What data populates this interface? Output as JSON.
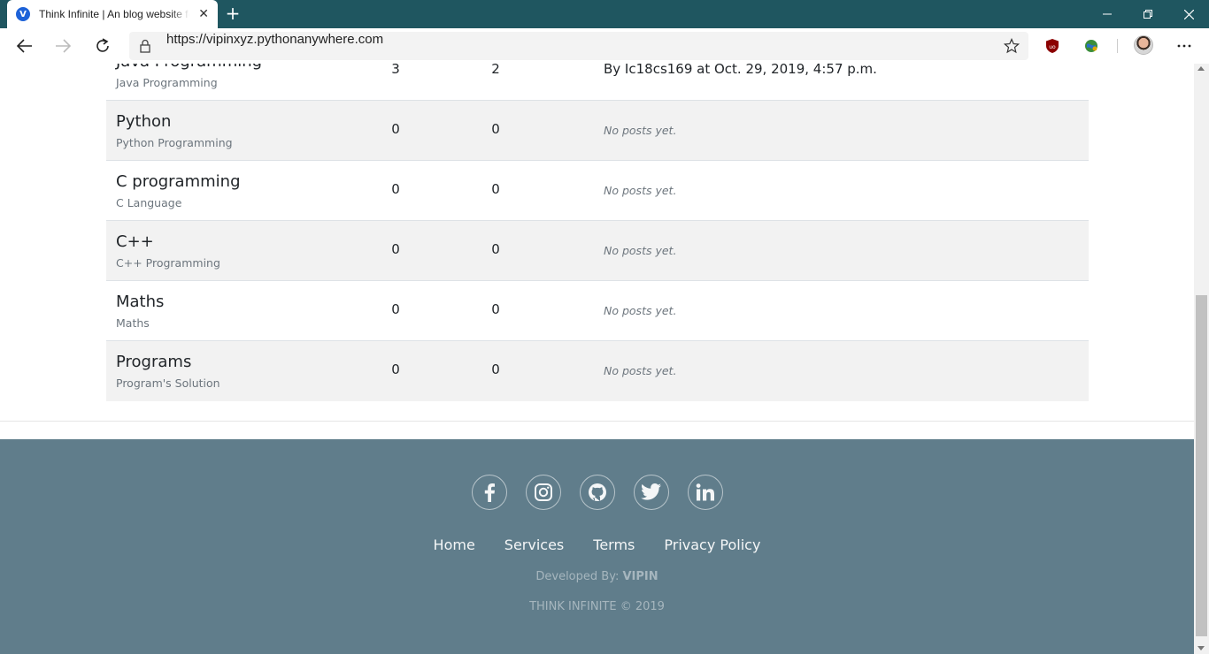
{
  "browser": {
    "tab_title": "Think Infinite | An blog website for",
    "tab_favicon_letter": "V",
    "url": "https://vipinxyz.pythonanywhere.com"
  },
  "categories": [
    {
      "name": "Java Programming",
      "description": "Java Programming",
      "posts": "3",
      "topics": "2",
      "last_post": "By Ic18cs169 at Oct. 29, 2019, 4:57 p.m."
    },
    {
      "name": "Python",
      "description": "Python Programming",
      "posts": "0",
      "topics": "0",
      "last_post": "No posts yet."
    },
    {
      "name": "C programming",
      "description": "C Language",
      "posts": "0",
      "topics": "0",
      "last_post": "No posts yet."
    },
    {
      "name": "C++",
      "description": "C++ Programming",
      "posts": "0",
      "topics": "0",
      "last_post": "No posts yet."
    },
    {
      "name": "Maths",
      "description": "Maths",
      "posts": "0",
      "topics": "0",
      "last_post": "No posts yet."
    },
    {
      "name": "Programs",
      "description": "Program's Solution",
      "posts": "0",
      "topics": "0",
      "last_post": "No posts yet."
    }
  ],
  "footer": {
    "social_icons": [
      "facebook-icon",
      "instagram-icon",
      "github-icon",
      "twitter-icon",
      "linkedin-icon"
    ],
    "links": [
      "Home",
      "Services",
      "Terms",
      "Privacy Policy"
    ],
    "developed_by_label": "Developed By:",
    "developer": "VIPIN",
    "copyright": "THINK INFINITE © 2019"
  },
  "colors": {
    "titlebar": "#1f5660",
    "footer_bg": "#607d8b",
    "alt_row": "#f2f2f2"
  }
}
